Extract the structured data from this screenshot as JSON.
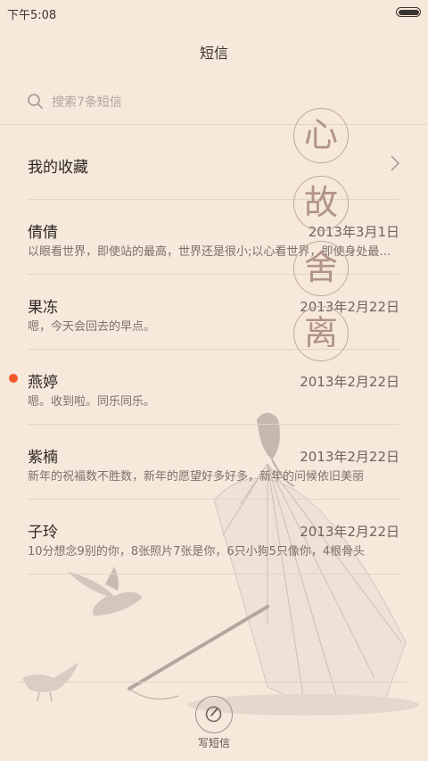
{
  "status_bar": {
    "time": "下午5:08"
  },
  "header": {
    "title": "短信"
  },
  "search": {
    "placeholder": "搜索7条短信"
  },
  "favorites": {
    "label": "我的收藏"
  },
  "conversations": [
    {
      "name": "倩倩",
      "date": "2013年3月1日",
      "preview": "以眼看世界，即使站的最高，世界还是很小;以心看世界，即使身处最低，世界也很大",
      "unread": false
    },
    {
      "name": "果冻",
      "date": "2013年2月22日",
      "preview": "嗯，今天会回去的早点。",
      "unread": false
    },
    {
      "name": "燕婷",
      "date": "2013年2月22日",
      "preview": "嗯。收到啦。同乐同乐。",
      "unread": true
    },
    {
      "name": "紫楠",
      "date": "2013年2月22日",
      "preview": "新年的祝福数不胜数，新年的愿望好多好多，新年的问候依旧美丽",
      "unread": false
    },
    {
      "name": "子玲",
      "date": "2013年2月22日",
      "preview": "10分想念9别的你，8张照片7张是你，6只小狗5只像你，4根骨头",
      "unread": false
    }
  ],
  "theme_seal": {
    "chars": [
      "心",
      "故",
      "舍",
      "离"
    ]
  },
  "compose": {
    "label": "写短信"
  },
  "colors": {
    "background": "#f7e8dc",
    "unread_dot": "#f4572a",
    "divider": "#e3d4c8"
  }
}
